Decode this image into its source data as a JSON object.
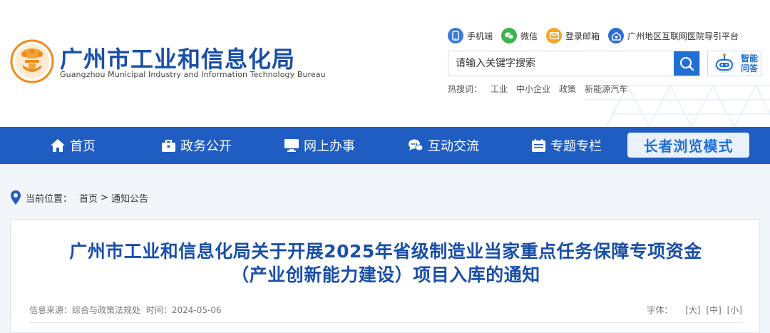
{
  "header": {
    "title": "广州市工业和信息化局",
    "subtitle": "Guangzhou Municipal Industry and Information Technology Bureau",
    "toplinks": [
      {
        "label": "手机端",
        "icon": "mobile-icon",
        "color": "#3a7bd5"
      },
      {
        "label": "微信",
        "icon": "wechat-icon",
        "color": "#3bb44a"
      },
      {
        "label": "登录邮箱",
        "icon": "mail-icon",
        "color": "#f5a623"
      },
      {
        "label": "广州地区互联网医院导引平台",
        "icon": "hospital-icon",
        "color": "#2d6fd1"
      }
    ],
    "search_placeholder": "请输入关键字搜索",
    "ai_label": "智能问答",
    "hot_label": "热搜词：",
    "hot_words": [
      "工业",
      "中小企业",
      "政策",
      "新能源汽车"
    ]
  },
  "nav": {
    "items": [
      {
        "label": "首页",
        "icon": "home-icon"
      },
      {
        "label": "政务公开",
        "icon": "briefcase-icon"
      },
      {
        "label": "网上办事",
        "icon": "monitor-icon"
      },
      {
        "label": "互动交流",
        "icon": "chat-icon"
      },
      {
        "label": "专题专栏",
        "icon": "calendar-icon"
      }
    ],
    "elder_mode": "长者浏览模式"
  },
  "breadcrumb": {
    "label": "当前位置：",
    "items": [
      "首页",
      "通知公告"
    ],
    "separator": ">"
  },
  "article": {
    "title_line1": "广州市工业和信息化局关于开展2025年省级制造业当家重点任务保障专项资金",
    "title_line2": "（产业创新能力建设）项目入库的通知",
    "source_label": "信息来源：",
    "source": "综合与政策法规处",
    "time_label": "时间：",
    "time": "2024-05-06",
    "font_label": "字体：",
    "font_sizes": [
      "[大]",
      "[中]",
      "[小]"
    ]
  },
  "colors": {
    "brand_blue": "#1f5dc2",
    "title_blue": "#1a4fa8",
    "emblem_orange": "#f08a1c"
  }
}
